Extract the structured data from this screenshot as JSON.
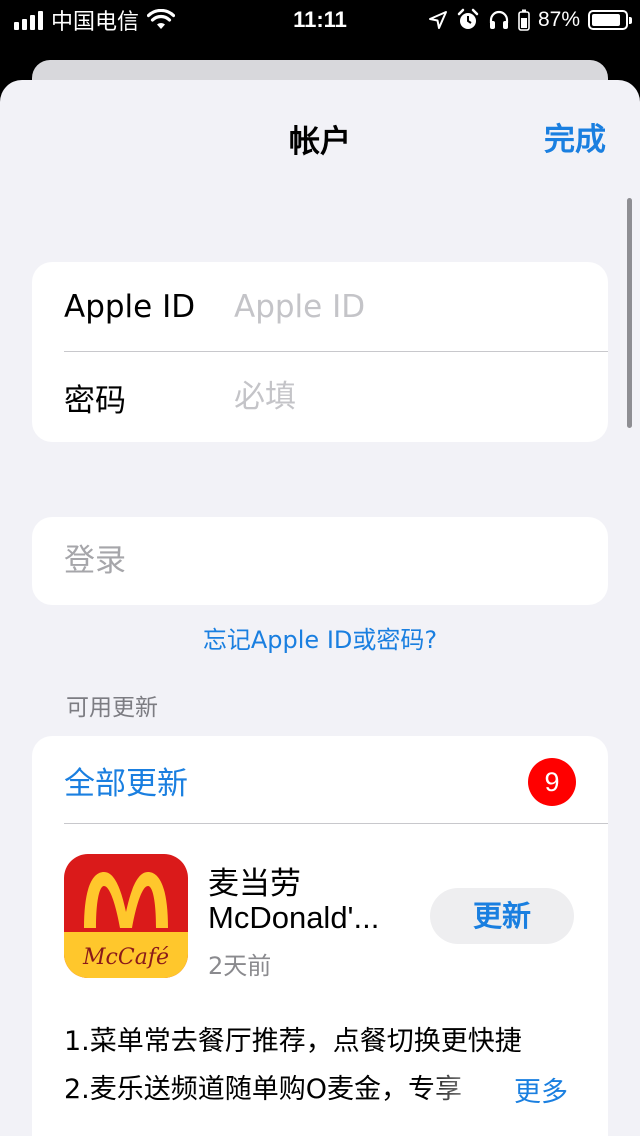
{
  "status_bar": {
    "carrier": "中国电信",
    "time": "11:11",
    "battery_percent": "87%",
    "battery_level": 0.87,
    "icons": [
      "signal-icon",
      "wifi-icon",
      "location-icon",
      "alarm-icon",
      "headphones-icon",
      "battery-icon"
    ]
  },
  "nav": {
    "title": "帐户",
    "done_label": "完成"
  },
  "login": {
    "apple_id_label": "Apple ID",
    "apple_id_placeholder": "Apple ID",
    "apple_id_value": "",
    "password_label": "密码",
    "password_placeholder": "必填",
    "password_value": ""
  },
  "signin": {
    "label": "登录"
  },
  "forgot_link": "忘记Apple ID或密码?",
  "updates": {
    "section_header": "可用更新",
    "update_all_label": "全部更新",
    "badge_count": "9",
    "apps": [
      {
        "name": "麦当劳",
        "subtitle": "McDonald'...",
        "date": "2天前",
        "update_label": "更新",
        "icon": "mcdonalds-app-icon",
        "icon_text": "McCafé",
        "notes": [
          "1.菜单常去餐厅推荐，点餐切换更快捷",
          "2.麦乐送频道随单购O麦金，专享"
        ],
        "more_label": "更多"
      }
    ]
  },
  "colors": {
    "accent": "#1a7fe0",
    "background": "#f2f2f7",
    "badge": "#ff0000"
  }
}
